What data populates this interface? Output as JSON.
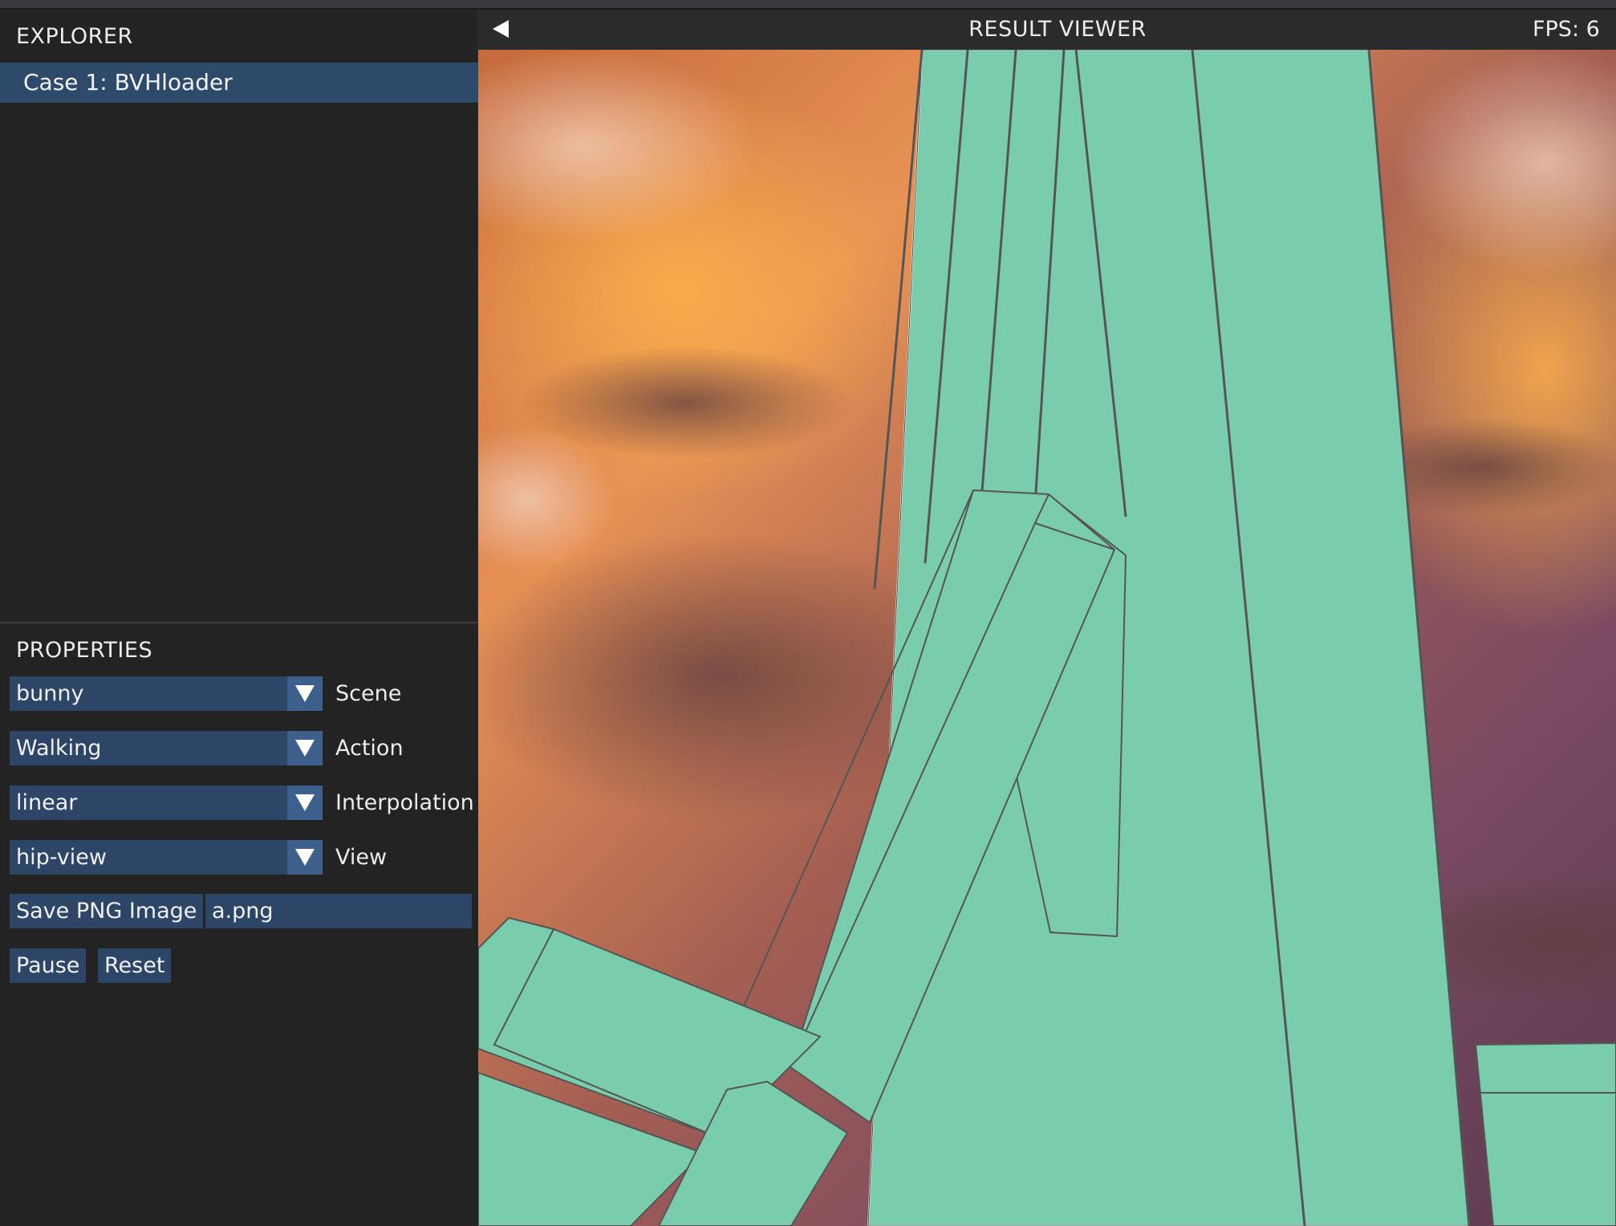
{
  "explorer": {
    "title": "EXPLORER",
    "items": [
      {
        "label": "Case 1: BVHloader",
        "selected": true
      }
    ]
  },
  "properties": {
    "title": "PROPERTIES",
    "dropdowns": [
      {
        "value": "bunny",
        "label": "Scene"
      },
      {
        "value": "Walking",
        "label": "Action"
      },
      {
        "value": "linear",
        "label": "Interpolation"
      },
      {
        "value": "hip-view",
        "label": "View"
      }
    ],
    "save_button_label": "Save PNG Image",
    "filename_value": "a.png",
    "pause_label": "Pause",
    "reset_label": "Reset"
  },
  "viewer": {
    "title": "RESULT VIEWER",
    "fps_label": "FPS:  6",
    "colors": {
      "mesh": "#79cdac",
      "sky_orange": "#e8874a",
      "sky_purple": "#7a4a62",
      "accent": "#2d4566"
    }
  },
  "icons": {
    "collapse": "triangle-left-icon",
    "dropdown": "triangle-down-icon"
  }
}
